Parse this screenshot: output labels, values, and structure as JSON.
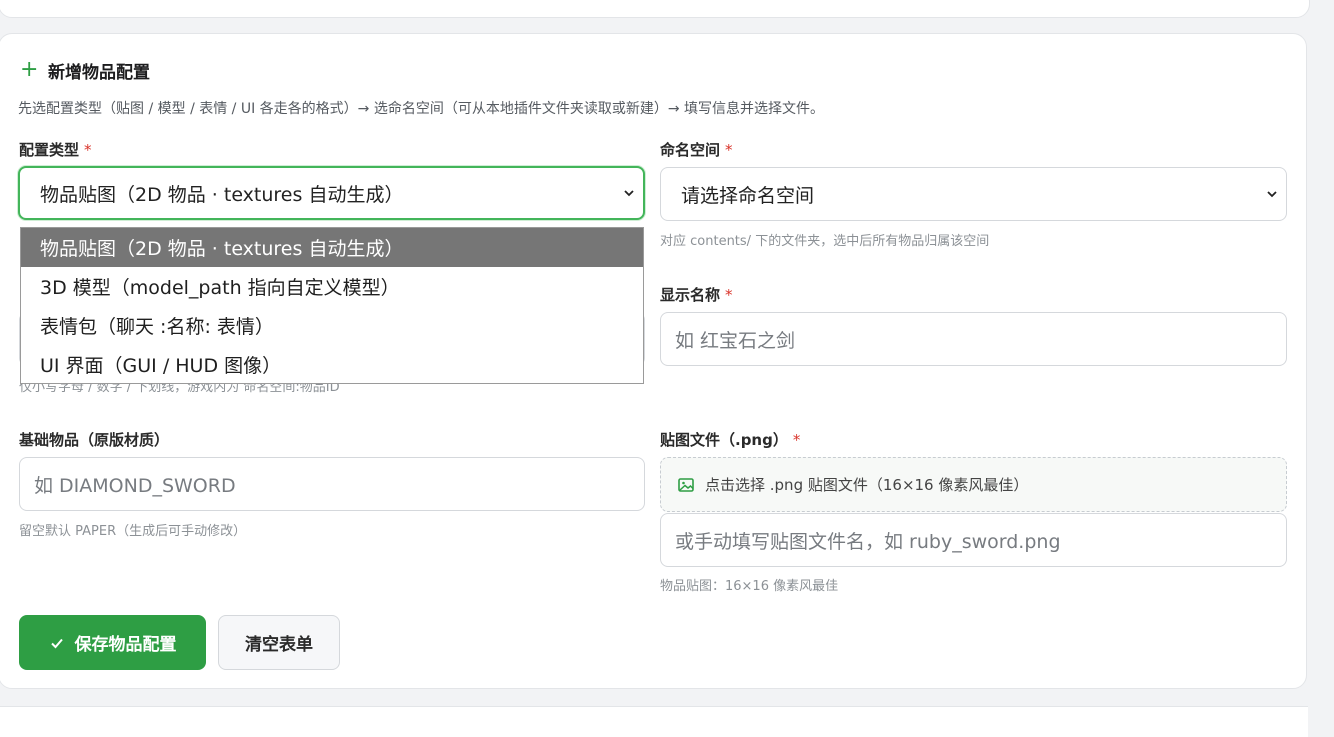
{
  "form": {
    "title": "新增物品配置",
    "description": "先选配置类型（贴图 / 模型 / 表情 / UI 各走各的格式）→ 选命名空间（可从本地插件文件夹读取或新建）→ 填写信息并选择文件。",
    "required_mark": "*",
    "config_type": {
      "label": "配置类型",
      "value": "物品贴图（2D 物品 · textures 自动生成）",
      "options": [
        "物品贴图（2D 物品 · textures 自动生成）",
        "3D 模型（model_path 指向自定义模型）",
        "表情包（聊天 :名称: 表情）",
        "UI 界面（GUI / HUD 图像）"
      ]
    },
    "namespace": {
      "label": "命名空间",
      "value": "请选择命名空间",
      "hint": "对应 contents/ 下的文件夹，选中后所有物品归属该空间"
    },
    "item_id": {
      "hint": "仅小写字母 / 数字 / 下划线，游戏内为 命名空间:物品ID"
    },
    "display_name": {
      "label": "显示名称",
      "placeholder": "如 红宝石之剑"
    },
    "base_item": {
      "label": "基础物品（原版材质）",
      "placeholder": "如 DIAMOND_SWORD",
      "hint": "留空默认 PAPER（生成后可手动修改）"
    },
    "texture_file": {
      "label": "贴图文件（.png）",
      "picker_text": "点击选择 .png 贴图文件（16×16 像素风最佳）",
      "placeholder": "或手动填写贴图文件名，如 ruby_sword.png",
      "hint": "物品贴图：16×16 像素风最佳"
    },
    "buttons": {
      "save": "保存物品配置",
      "clear": "清空表单"
    }
  },
  "colors": {
    "accent": "#2e9e44",
    "required": "#d9342b",
    "focus_border": "#43b55a",
    "dropdown_selected": "#767676"
  },
  "icons": [
    "plus-icon",
    "chevron-down-icon",
    "image-icon",
    "check-icon"
  ]
}
